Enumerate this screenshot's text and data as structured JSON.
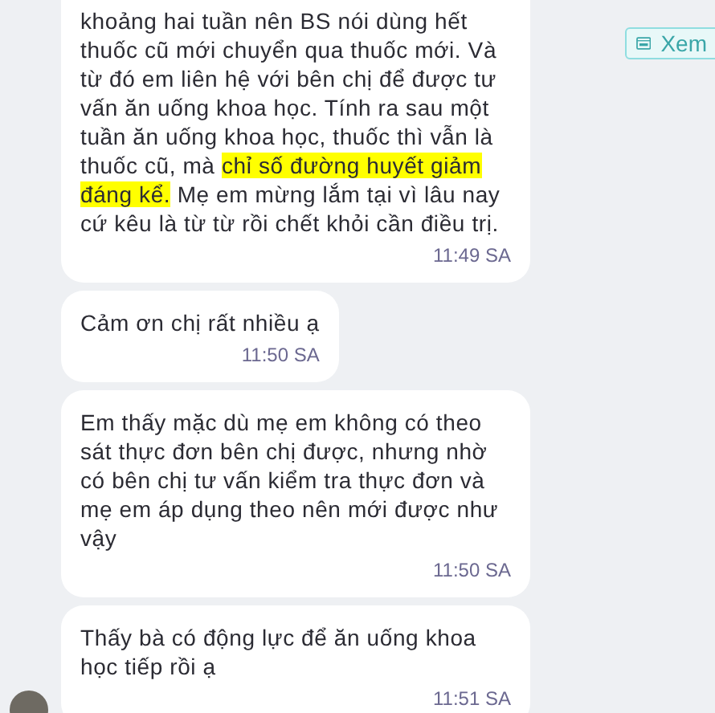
{
  "messages": [
    {
      "segments": [
        {
          "text": "khoảng hai tuần nên BS nói dùng hết thuốc cũ mới chuyển qua thuốc mới. Và từ đó em liên hệ với bên chị để được tư vấn ăn uống khoa học. Tính ra sau một tuần ăn uống khoa học, thuốc thì vẫn là thuốc cũ, mà ",
          "highlighted": false
        },
        {
          "text": "chỉ số đường huyết giảm đáng kể.",
          "highlighted": true
        },
        {
          "text": " Mẹ em mừng lắm tại vì lâu nay cứ kêu là từ từ rồi chết khỏi cần điều trị.",
          "highlighted": false
        }
      ],
      "time": "11:49 SA"
    },
    {
      "segments": [
        {
          "text": "Cảm ơn chị rất nhiều ạ",
          "highlighted": false
        }
      ],
      "time": "11:50 SA"
    },
    {
      "segments": [
        {
          "text": "Em thấy mặc dù mẹ em không có theo sát thực đơn bên chị được, nhưng nhờ có bên chị tư vấn kiểm tra thực đơn và mẹ em áp dụng theo nên mới được như vậy",
          "highlighted": false
        }
      ],
      "time": "11:50 SA"
    },
    {
      "segments": [
        {
          "text": "Thấy bà có động lực để ăn uống khoa học tiếp rồi ạ",
          "highlighted": false
        }
      ],
      "time": "11:51 SA"
    }
  ],
  "view_button": {
    "label": "Xem"
  }
}
